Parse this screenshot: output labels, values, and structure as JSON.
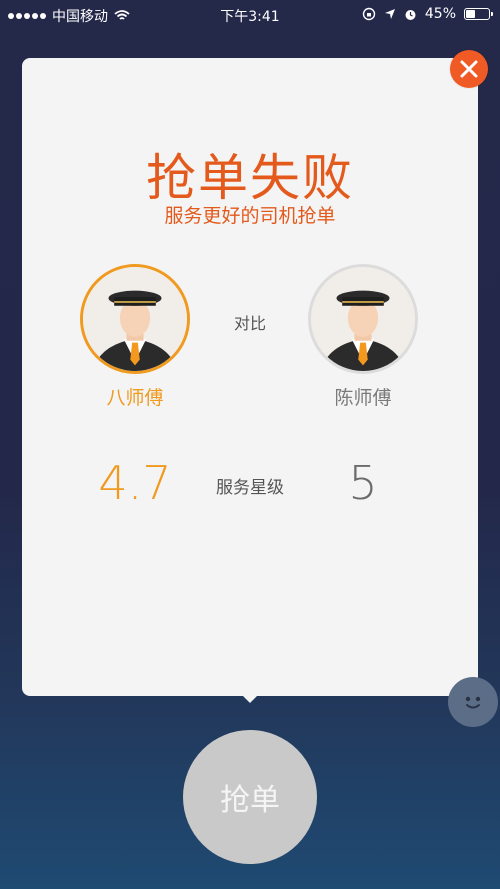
{
  "status_bar": {
    "carrier": "中国移动",
    "time": "下午3:41",
    "battery": "45%",
    "battery_level": 0.45
  },
  "dialog": {
    "title": "抢单失败",
    "subtitle": "服务更好的司机抢单",
    "compare_label": "对比",
    "metric_label": "服务星级",
    "left_driver": {
      "name": "八师傅",
      "score": "4.7"
    },
    "right_driver": {
      "name": "陈师傅",
      "score": "5"
    },
    "close_icon": "close-icon"
  },
  "actions": {
    "grab_label": "抢单",
    "face_icon": "smiley-face-icon"
  },
  "colors": {
    "accent_orange": "#f09a1f",
    "title_red": "#e35a1c",
    "close_bg": "#f05a24"
  }
}
